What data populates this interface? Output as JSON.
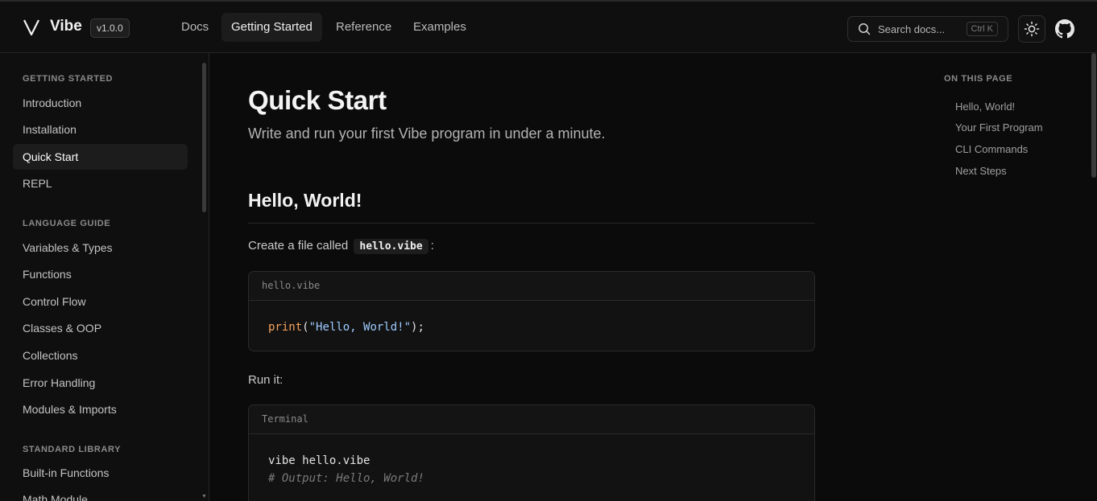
{
  "header": {
    "brand": "Vibe",
    "version": "v1.0.0",
    "nav": [
      {
        "label": "Docs"
      },
      {
        "label": "Getting Started"
      },
      {
        "label": "Reference"
      },
      {
        "label": "Examples"
      }
    ],
    "search": {
      "placeholder": "Search docs...",
      "shortcut": "Ctrl K"
    }
  },
  "sidebar": {
    "sections": [
      {
        "title": "GETTING STARTED",
        "items": [
          "Introduction",
          "Installation",
          "Quick Start",
          "REPL"
        ]
      },
      {
        "title": "LANGUAGE GUIDE",
        "items": [
          "Variables & Types",
          "Functions",
          "Control Flow",
          "Classes & OOP",
          "Collections",
          "Error Handling",
          "Modules & Imports"
        ]
      },
      {
        "title": "STANDARD LIBRARY",
        "items": [
          "Built-in Functions",
          "Math Module"
        ]
      }
    ],
    "active": "Quick Start"
  },
  "main": {
    "title": "Quick Start",
    "subtitle": "Write and run your first Vibe program in under a minute.",
    "section_title": "Hello, World!",
    "intro_before": "Create a file called",
    "intro_code": "hello.vibe",
    "intro_after": ":",
    "code1": {
      "filename": "hello.vibe",
      "fn": "print",
      "open": "(",
      "str": "\"Hello, World!\"",
      "close": ");"
    },
    "run_label": "Run it:",
    "code2": {
      "filename": "Terminal",
      "command": "vibe hello.vibe",
      "comment": "# Output: Hello, World!"
    }
  },
  "toc": {
    "title": "ON THIS PAGE",
    "items": [
      "Hello, World!",
      "Your First Program",
      "CLI Commands",
      "Next Steps"
    ]
  },
  "colors": {
    "background": "#0b0b0b",
    "accent_string": "#9ecbff",
    "accent_function": "#f5a35c"
  }
}
